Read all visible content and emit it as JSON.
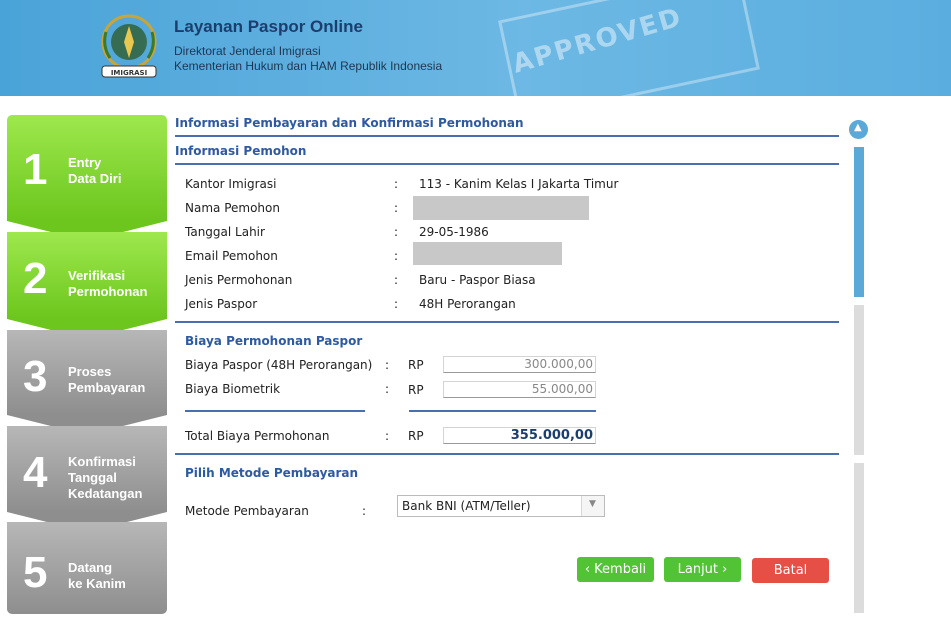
{
  "header": {
    "title": "Layanan Paspor Online",
    "subtitle_1": "Direktorat Jenderal Imigrasi",
    "subtitle_2": "Kementerian Hukum dan HAM Republik Indonesia",
    "logo_text": "IMIGRASI",
    "watermark_text": "APPROVED"
  },
  "steps": [
    {
      "number": "1",
      "label": "Entry\nData Diri",
      "state": "done"
    },
    {
      "number": "2",
      "label": "Verifikasi\nPermohonan",
      "state": "done"
    },
    {
      "number": "3",
      "label": "Proses\nPembayaran",
      "state": "pending"
    },
    {
      "number": "4",
      "label": "Konfirmasi\nTanggal\nKedatangan",
      "state": "pending"
    },
    {
      "number": "5",
      "label": "Datang\nke Kanim",
      "state": "pending"
    }
  ],
  "page_title": "Informasi Pembayaran dan Konfirmasi Permohonan",
  "applicant": {
    "section_title": "Informasi Pemohon",
    "rows": [
      {
        "label": "Kantor Imigrasi",
        "value": "113 - Kanim Kelas I Jakarta Timur"
      },
      {
        "label": "Nama Pemohon",
        "value": ""
      },
      {
        "label": "Tanggal Lahir",
        "value": "29-05-1986"
      },
      {
        "label": "Email Pemohon",
        "value": ""
      },
      {
        "label": "Jenis Permohonan",
        "value": "Baru - Paspor Biasa"
      },
      {
        "label": "Jenis Paspor",
        "value": "48H Perorangan"
      }
    ]
  },
  "fees": {
    "section_title": "Biaya Permohonan Paspor",
    "currency": "RP",
    "items": [
      {
        "label": "Biaya Paspor (48H Perorangan)",
        "amount": "300.000,00"
      },
      {
        "label": "Biaya Biometrik",
        "amount": "55.000,00"
      }
    ],
    "total_label": "Total Biaya Permohonan",
    "total_amount": "355.000,00"
  },
  "payment": {
    "section_title": "Pilih Metode Pembayaran",
    "method_label": "Metode Pembayaran",
    "selected_method": "Bank BNI (ATM/Teller)"
  },
  "buttons": {
    "back": "Kembali",
    "next": "Lanjut",
    "cancel": "Batal"
  },
  "colors": {
    "accent_blue": "#4a6fb1",
    "step_green": "#6cc61d",
    "step_gray": "#8e8e8e",
    "button_green": "#52c334",
    "button_red": "#e64f45"
  }
}
